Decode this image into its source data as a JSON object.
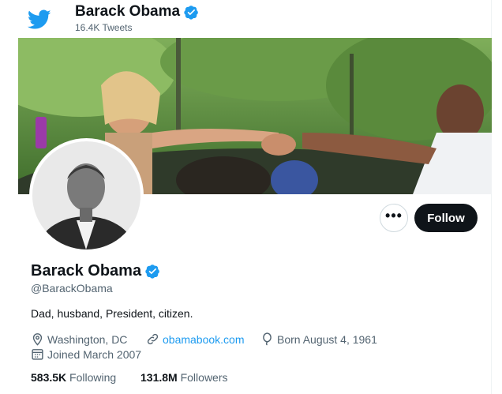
{
  "header": {
    "logo_icon": "twitter-bird-icon",
    "name": "Barack Obama",
    "tweet_count": "16.4K Tweets"
  },
  "banner": {
    "description_icon": "banner-photo"
  },
  "actions": {
    "more_label": "•••",
    "follow_label": "Follow"
  },
  "profile": {
    "name": "Barack Obama",
    "handle": "@BarackObama",
    "bio": "Dad, husband, President, citizen.",
    "location": "Washington, DC",
    "website": "obamabook.com",
    "born": "Born August 4, 1961",
    "joined": "Joined March 2007",
    "following_count": "583.5K",
    "following_label": "Following",
    "followers_count": "131.8M",
    "followers_label": "Followers"
  },
  "colors": {
    "accent": "#1d9bf0",
    "text": "#0f1419",
    "muted": "#536471",
    "follow_bg": "#0f1419"
  }
}
